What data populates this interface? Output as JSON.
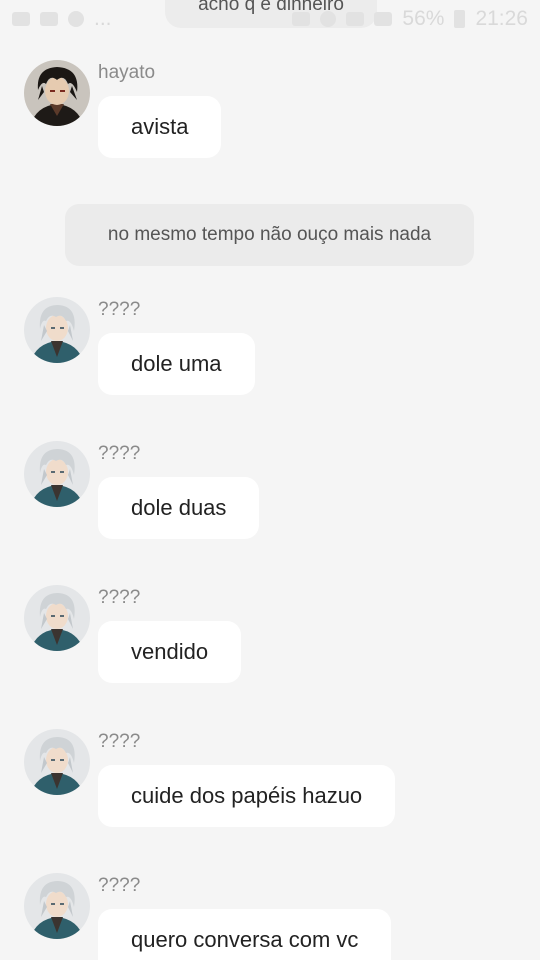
{
  "status_bar": {
    "battery": "56%",
    "time": "21:26",
    "dots": "..."
  },
  "top_message": {
    "text": "acho q é dinheiro"
  },
  "messages": [
    {
      "sender": "hayato",
      "text": "avista",
      "avatar": "dark-haired-character"
    },
    {
      "sender": "????",
      "text": "dole uma",
      "avatar": "silver-haired-character"
    },
    {
      "sender": "????",
      "text": "dole duas",
      "avatar": "silver-haired-character"
    },
    {
      "sender": "????",
      "text": "vendido",
      "avatar": "silver-haired-character"
    },
    {
      "sender": "????",
      "text": "cuide dos papéis hazuo",
      "avatar": "silver-haired-character"
    },
    {
      "sender": "????",
      "text": "quero conversa com vc",
      "avatar": "silver-haired-character"
    }
  ],
  "system_message": {
    "text": "no mesmo tempo não ouço mais nada"
  },
  "colors": {
    "background": "#f5f5f5",
    "bubble": "#ffffff",
    "system_bubble": "#ebebeb",
    "name": "#8a8a8a"
  }
}
